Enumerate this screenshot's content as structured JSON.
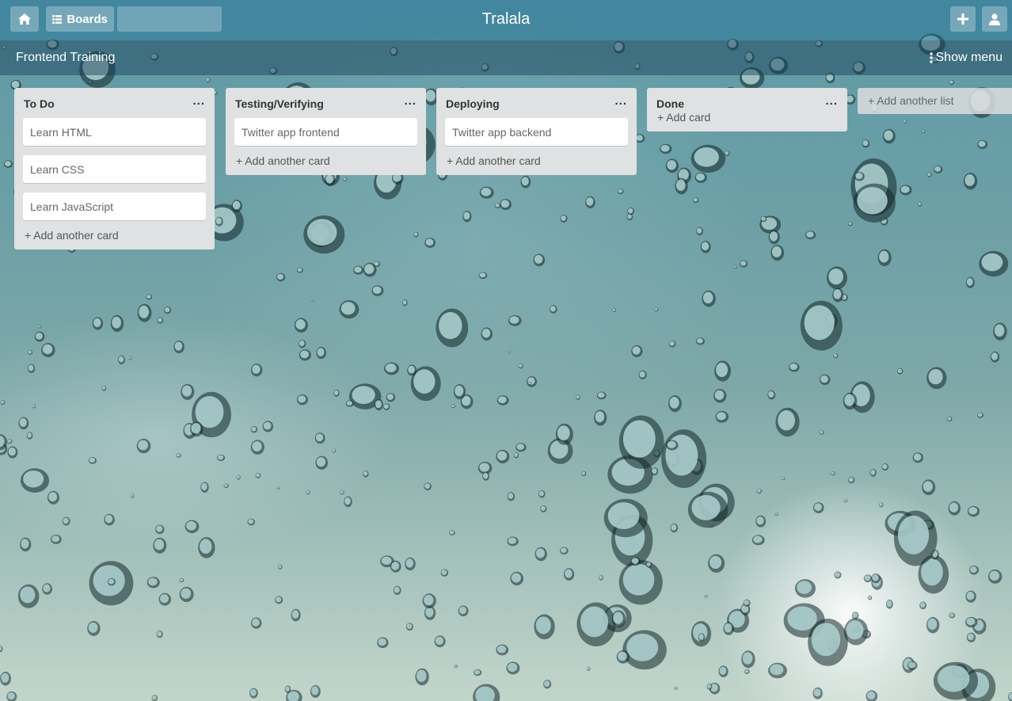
{
  "header": {
    "app_title": "Tralala",
    "boards_label": "Boards",
    "search_value": "",
    "icons": [
      "home-icon",
      "boards-icon",
      "plus-icon",
      "user-icon"
    ]
  },
  "board": {
    "title": "Frontend Training",
    "show_menu_label": "Show menu"
  },
  "lists": [
    {
      "title": "To Do",
      "more": "...",
      "cards": [
        "Learn HTML",
        "Learn CSS",
        "Learn JavaScript"
      ],
      "add_label": "+ Add another card"
    },
    {
      "title": "Testing/Verifying",
      "more": "...",
      "cards": [
        "Twitter app frontend"
      ],
      "add_label": "+ Add another card"
    },
    {
      "title": "Deploying",
      "more": "...",
      "cards": [
        "Twitter app backend"
      ],
      "add_label": "+ Add another card"
    },
    {
      "title": "Done",
      "more": "...",
      "cards": [],
      "add_label": "+ Add card"
    }
  ],
  "add_list_label": "+ Add another list",
  "colors": {
    "topbar": "#3d7f9c",
    "list_bg": "#dfe1e2",
    "card_bg": "#ffffff"
  }
}
